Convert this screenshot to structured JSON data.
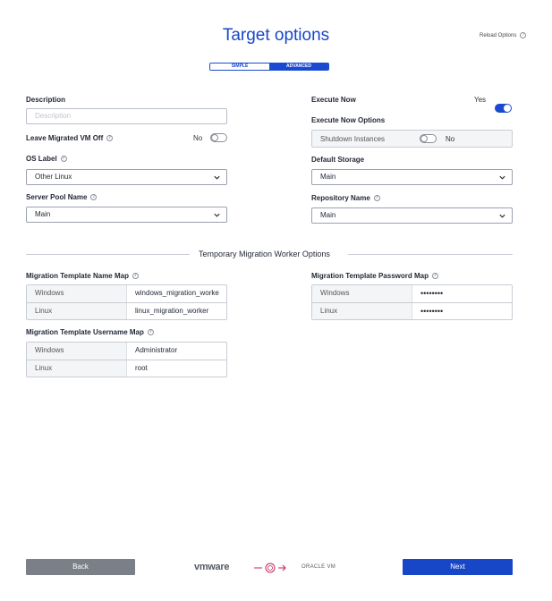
{
  "header": {
    "title": "Target options",
    "reload_label": "Reload Options",
    "mode_simple": "SIMPLE",
    "mode_advanced": "ADVANCED"
  },
  "left": {
    "description_label": "Description",
    "description_placeholder": "Description",
    "leave_off_label": "Leave Migrated VM Off",
    "leave_off_value": "No",
    "os_label_label": "OS Label",
    "os_label_value": "Other Linux",
    "server_pool_label": "Server Pool Name",
    "server_pool_value": "Main"
  },
  "right": {
    "execute_now_label": "Execute Now",
    "execute_now_value": "Yes",
    "execute_options_label": "Execute Now Options",
    "shutdown_label": "Shutdown Instances",
    "shutdown_value": "No",
    "default_storage_label": "Default Storage",
    "default_storage_value": "Main",
    "repository_label": "Repository Name",
    "repository_value": "Main"
  },
  "worker": {
    "section_title": "Temporary Migration Worker Options",
    "name_map_label": "Migration Template Name Map",
    "name_map": [
      {
        "key": "Windows",
        "value": "windows_migration_worke"
      },
      {
        "key": "Linux",
        "value": "linux_migration_worker"
      }
    ],
    "username_map_label": "Migration Template Username Map",
    "username_map": [
      {
        "key": "Windows",
        "value": "Administrator"
      },
      {
        "key": "Linux",
        "value": "root"
      }
    ],
    "password_map_label": "Migration Template Password Map",
    "password_map": [
      {
        "key": "Windows",
        "value": "••••••••"
      },
      {
        "key": "Linux",
        "value": "••••••••"
      }
    ]
  },
  "footer": {
    "back_label": "Back",
    "next_label": "Next",
    "vmware_logo": "vmware",
    "oracle_logo": "ORACLE VM"
  },
  "colors": {
    "accent": "#1747c7",
    "back_button": "#7b7f87"
  }
}
